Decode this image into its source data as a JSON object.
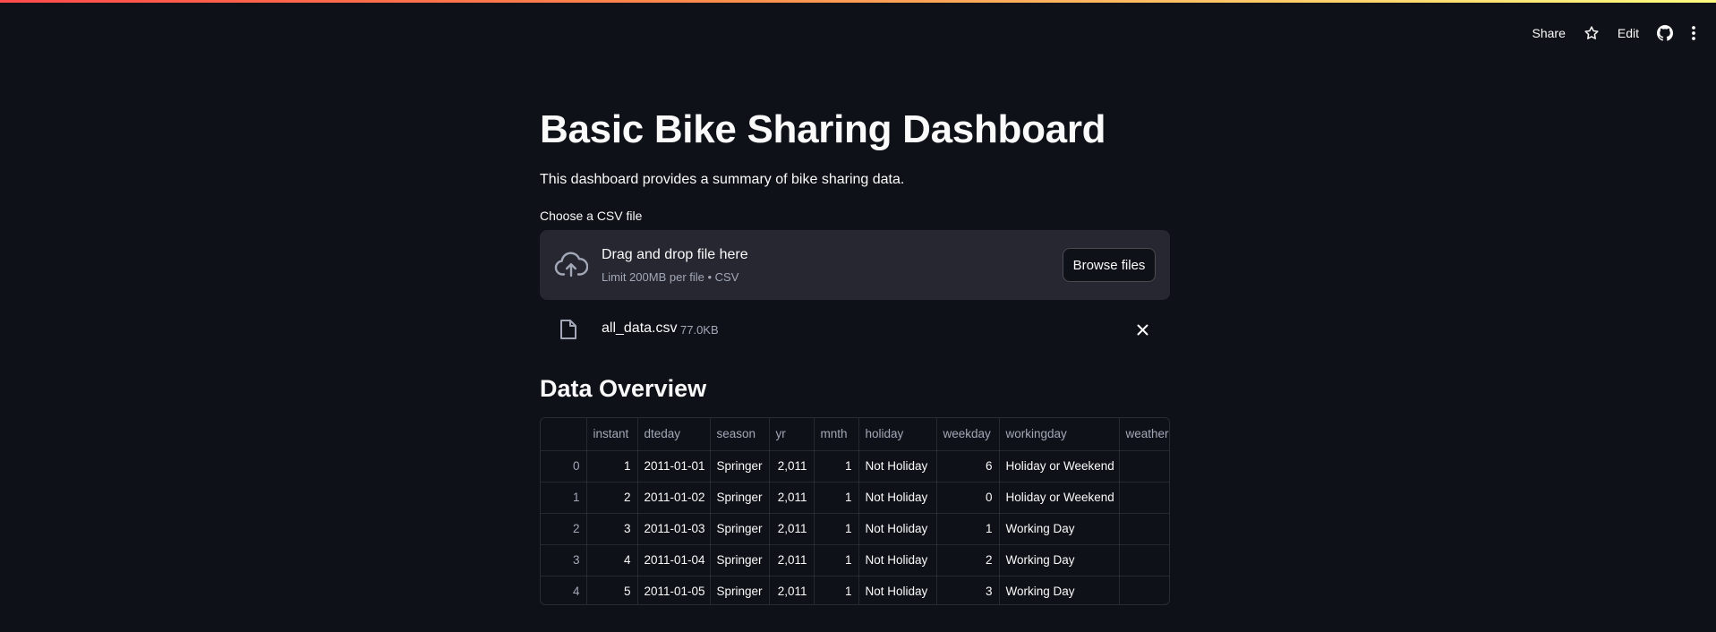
{
  "header": {
    "share_label": "Share",
    "edit_label": "Edit",
    "icons": [
      "star-icon",
      "github-icon",
      "more-vert-icon"
    ]
  },
  "page": {
    "title": "Basic Bike Sharing Dashboard",
    "subtitle": "This dashboard provides a summary of bike sharing data."
  },
  "uploader": {
    "label": "Choose a CSV file",
    "drop_text": "Drag and drop file here",
    "limit_text": "Limit 200MB per file • CSV",
    "browse_label": "Browse files",
    "file": {
      "name": "all_data.csv",
      "size": "77.0KB"
    }
  },
  "overview": {
    "title": "Data Overview",
    "columns": [
      "",
      "instant",
      "dteday",
      "season",
      "yr",
      "mnth",
      "holiday",
      "weekday",
      "workingday",
      "weathers"
    ],
    "rows": [
      [
        "0",
        "1",
        "2011-01-01",
        "Springer",
        "2,011",
        "1",
        "Not Holiday",
        "6",
        "Holiday or Weekend",
        ""
      ],
      [
        "1",
        "2",
        "2011-01-02",
        "Springer",
        "2,011",
        "1",
        "Not Holiday",
        "0",
        "Holiday or Weekend",
        ""
      ],
      [
        "2",
        "3",
        "2011-01-03",
        "Springer",
        "2,011",
        "1",
        "Not Holiday",
        "1",
        "Working Day",
        ""
      ],
      [
        "3",
        "4",
        "2011-01-04",
        "Springer",
        "2,011",
        "1",
        "Not Holiday",
        "2",
        "Working Day",
        ""
      ],
      [
        "4",
        "5",
        "2011-01-05",
        "Springer",
        "2,011",
        "1",
        "Not Holiday",
        "3",
        "Working Day",
        ""
      ]
    ]
  },
  "colors": {
    "background": "#0e1117",
    "surface": "#262730",
    "text": "#fafafa",
    "muted": "#a3a8b8",
    "accent_gradient": [
      "#ff4b4b",
      "#fffd80"
    ]
  }
}
